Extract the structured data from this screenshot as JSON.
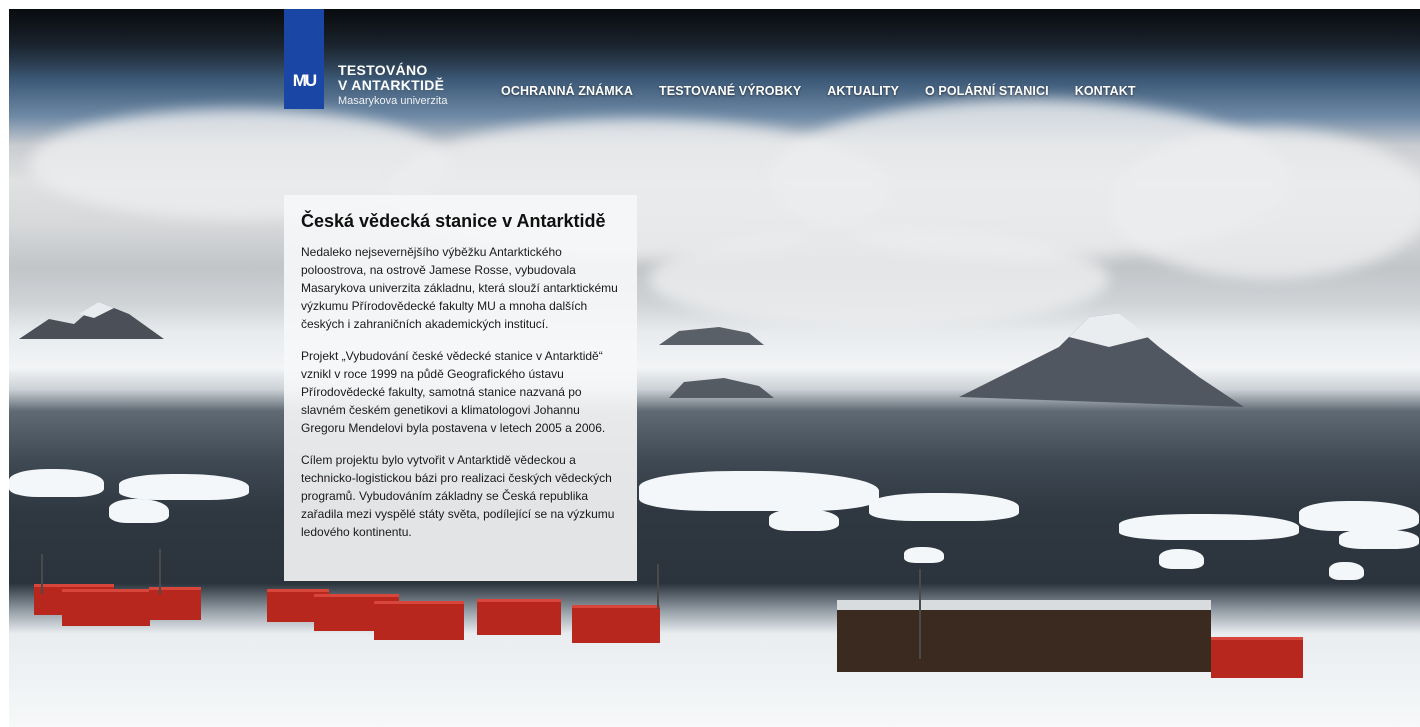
{
  "logo": {
    "mark": "MU",
    "line1": "TESTOVÁNO",
    "line2": "V ANTARKTIDĚ",
    "subtitle": "Masarykova univerzita"
  },
  "nav": {
    "items": [
      {
        "label": "OCHRANNÁ ZNÁMKA"
      },
      {
        "label": "TESTOVANÉ VÝROBKY"
      },
      {
        "label": "AKTUALITY"
      },
      {
        "label": "O POLÁRNÍ STANICI"
      },
      {
        "label": "KONTAKT"
      }
    ]
  },
  "panel": {
    "title": "Česká vědecká stanice v Antarktidě",
    "paragraphs": [
      "Nedaleko nejsevernějšího výběžku Antarktického poloostrova, na ostrově Jamese Rosse, vybudovala Masarykova univerzita základnu, která slouží antarktickému výzkumu Přírodovědecké fakulty MU a mnoha dalších českých i zahraničních akademických institucí.",
      "Projekt „Vybudování české vědecké stanice v Antarktidě“ vznikl v roce 1999 na půdě Geografického ústavu Přírodovědecké fakulty, samotná stanice nazvaná po slavném českém genetikovi a klimatologovi Johannu Gregoru Mendelovi byla postavena v letech 2005 a 2006.",
      "Cílem projektu bylo vytvořit v Antarktidě vědeckou a technicko-logistickou bázi pro realizaci českých vědeckých programů. Vybudováním základny se Česká republika zařadila mezi vyspělé státy světa, podílející se na výzkumu ledového kontinentu."
    ]
  },
  "colors": {
    "brand_blue": "#1a46a5",
    "container_red": "#b8271e"
  }
}
